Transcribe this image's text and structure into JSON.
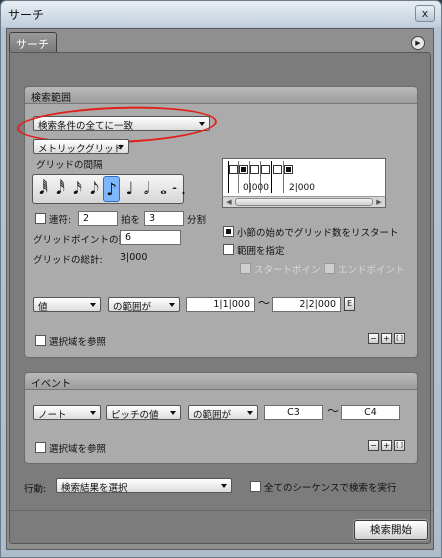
{
  "window": {
    "title": "サーチ",
    "close": "x"
  },
  "panel": {
    "tab": "サーチ",
    "menu_icon": "▶"
  },
  "search_range": {
    "header": "検索範囲",
    "condition_dropdown": "検索条件の全てに一致",
    "grid_type_dropdown": "メトリックグリッド",
    "grid_spacing_label": "グリッドの間隔",
    "note_values": [
      "𝅘𝅥𝅱",
      "𝅘𝅥𝅰",
      "𝅘𝅥𝅯",
      "𝅘𝅥𝅮",
      "♪",
      "♩",
      "𝅗𝅥",
      "𝅝",
      "𝄼",
      "."
    ],
    "selected_note_index": 4,
    "tuplet_label": "連符:",
    "tuplet_value": "2",
    "tuplet_beats_label": "拍を",
    "tuplet_beats_value": "3",
    "tuplet_divide_label": "分割",
    "grid_points_label": "グリッドポイントの数:",
    "grid_points_value": "6",
    "grid_total_label": "グリッドの総計:",
    "grid_total_value": "3|000",
    "grid_preview_labels": [
      "0|000",
      "2|000"
    ],
    "restart_label": "小節の始めでグリッド数をリスタート",
    "specify_range_label": "範囲を指定",
    "start_point_label": "スタートポイント",
    "end_point_label": "エンドポイント",
    "value_dropdown": "値",
    "range_dropdown": "の範囲が",
    "range_from": "1|1|000",
    "range_to": "2|2|000",
    "tilde": "〜",
    "e_button": "E",
    "use_selection_label": "選択域を参照",
    "minus": "−",
    "plus": "+",
    "bracket": "[ ]"
  },
  "event": {
    "header": "イベント",
    "type_dropdown": "ノート",
    "property_dropdown": "ピッチの値",
    "range_dropdown": "の範囲が",
    "from": "C3",
    "to": "C4",
    "tilde": "〜",
    "use_selection_label": "選択域を参照",
    "minus": "−",
    "plus": "+",
    "bracket": "[ ]"
  },
  "footer": {
    "action_label": "行動:",
    "action_dropdown": "検索結果を選択",
    "all_sequences_label": "全てのシーケンスで検索を実行",
    "search_button": "検索開始"
  }
}
